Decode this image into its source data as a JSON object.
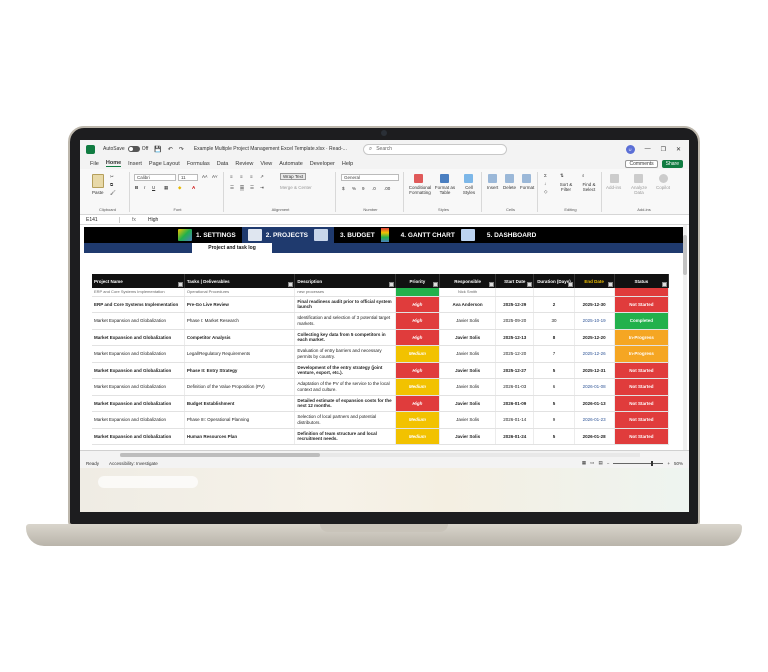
{
  "window": {
    "autosave_label": "AutoSave",
    "autosave_state": "Off",
    "doc_title": "Example Multiple Project Management Excel Template.xlsx  ·  Read-...",
    "search_placeholder": "Search"
  },
  "menu": [
    "File",
    "Home",
    "Insert",
    "Page Layout",
    "Formulas",
    "Data",
    "Review",
    "View",
    "Automate",
    "Developer",
    "Help"
  ],
  "menu_active": "Home",
  "comments_label": "Comments",
  "share_label": "Share",
  "ribbon": {
    "groups": [
      "Clipboard",
      "Font",
      "Alignment",
      "Number",
      "Styles",
      "Cells",
      "Editing",
      "Add-ins"
    ],
    "paste": "Paste",
    "font_name": "Calibri",
    "font_size": "11",
    "wrap_text": "Wrap Text",
    "merge_center": "Merge & Center",
    "number_format": "General",
    "cond_format": "Conditional Formatting",
    "format_table": "Format as Table",
    "cell_styles": "Cell Styles",
    "insert": "Insert",
    "delete": "Delete",
    "format": "Format",
    "sort_filter": "Sort & Filter",
    "find_select": "Find & Select",
    "add_ins": "Add-ins",
    "analyze": "Analyze Data",
    "copilot": "Copilot"
  },
  "formula": {
    "cell_ref": "E141",
    "fx": "fx",
    "value": "High"
  },
  "nav": [
    "1. SETTINGS",
    "2. PROJECTS",
    "3. BUDGET",
    "4. GANTT CHART",
    "5. DASHBOARD"
  ],
  "nav_active": "2. PROJECTS",
  "subtab": "Project and task log",
  "columns": [
    "Project Name",
    "Tasks | Deliverables",
    "Description",
    "Priority",
    "Responsible",
    "Start Date",
    "Duration (Days)",
    "End Date",
    "Status"
  ],
  "partial_row": {
    "project": "ERP and Core Systems Implementation",
    "task": "Operational Procedures",
    "desc": "new processes",
    "resp": "Nick Smith"
  },
  "rows": [
    {
      "project": "ERP and Core Systems Implementation",
      "bold": true,
      "task": "Pre-Go Live Review",
      "desc": "Final readiness audit prior to official system launch",
      "priority": "High",
      "resp": "Ava Anderson",
      "start": "2025-12-29",
      "dur": "2",
      "end": "2025-12-30",
      "status": "Not Started"
    },
    {
      "project": "Market Expansion and Globalization",
      "bold": false,
      "task": "Phase I: Market Research",
      "desc": "Identification and selection of 3 potential target markets.",
      "priority": "High",
      "resp": "Javier Solis",
      "start": "2025-09-20",
      "dur": "30",
      "end": "2025-10-19",
      "status": "Completed"
    },
    {
      "project": "Market Expansion and Globalization",
      "bold": true,
      "task": "Competitor Analysis",
      "desc": "Collecting key data from 5 competitors in each market.",
      "priority": "High",
      "resp": "Javier Solis",
      "start": "2025-12-13",
      "dur": "8",
      "end": "2025-12-20",
      "status": "In-Progress"
    },
    {
      "project": "Market Expansion and Globalization",
      "bold": false,
      "task": "Legal/Regulatory Requirements",
      "desc": "Evaluation of entry barriers and necessary permits by country.",
      "priority": "Medium",
      "resp": "Javier Solis",
      "start": "2025-12-20",
      "dur": "7",
      "end": "2025-12-26",
      "status": "In-Progress"
    },
    {
      "project": "Market Expansion and Globalization",
      "bold": true,
      "task": "Phase II: Entry Strategy",
      "desc": "Development of the entry strategy (joint venture, export, etc.).",
      "priority": "High",
      "resp": "Javier Solis",
      "start": "2025-12-27",
      "dur": "5",
      "end": "2025-12-31",
      "status": "Not Started"
    },
    {
      "project": "Market Expansion and Globalization",
      "bold": false,
      "task": "Definition of the Value Proposition (PV)",
      "desc": "Adaptation of the PV of the service to the local context and culture.",
      "priority": "Medium",
      "resp": "Javier Solis",
      "start": "2026-01-03",
      "dur": "6",
      "end": "2026-01-08",
      "status": "Not Started"
    },
    {
      "project": "Market Expansion and Globalization",
      "bold": true,
      "task": "Budget Establishment",
      "desc": "Detailed estimate of expansion costs for the next 12 months.",
      "priority": "High",
      "resp": "Javier Solis",
      "start": "2026-01-09",
      "dur": "5",
      "end": "2026-01-13",
      "status": "Not Started"
    },
    {
      "project": "Market Expansion and Globalization",
      "bold": false,
      "task": "Phase III: Operational Planning",
      "desc": "Selection of local partners and potential distributors.",
      "priority": "Medium",
      "resp": "Javier Solis",
      "start": "2026-01-14",
      "dur": "9",
      "end": "2026-01-23",
      "status": "Not Started"
    },
    {
      "project": "Market Expansion and Globalization",
      "bold": true,
      "task": "Human Resources Plan",
      "desc": "Definition of team structure and local recruitment needs.",
      "priority": "Medium",
      "resp": "Javier Solis",
      "start": "2026-01-24",
      "dur": "5",
      "end": "2026-01-28",
      "status": "Not Started"
    }
  ],
  "status_bar": {
    "ready": "Ready",
    "accessibility": "Accessibility: Investigate",
    "zoom": "50%"
  },
  "colors": {
    "excel_green": "#107c41",
    "nav_blue": "#1f3a6e",
    "high": "#e03c3c",
    "medium": "#f2c200",
    "completed": "#22b14c",
    "in_progress": "#f5a623"
  }
}
